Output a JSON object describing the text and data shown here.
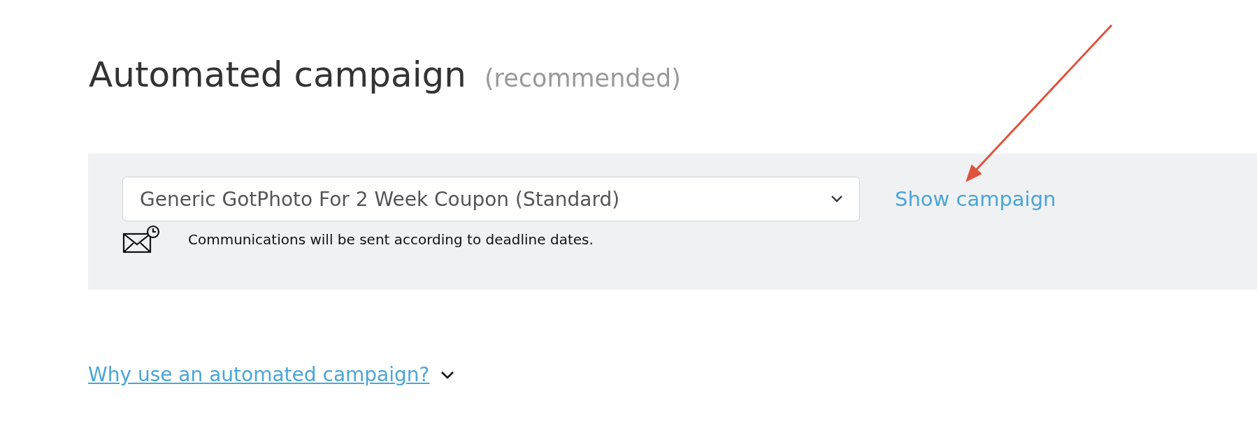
{
  "heading": {
    "title": "Automated campaign",
    "note": "(recommended)"
  },
  "campaign_panel": {
    "select": {
      "value": "Generic GotPhoto For 2 Week Coupon (Standard)"
    },
    "link": "Show campaign",
    "info": "Communications will be sent according to deadline dates."
  },
  "faq": {
    "label": "Why use an automated campaign?",
    "expanded": false
  },
  "annotation": {
    "kind": "arrow",
    "color": "#e0533d"
  }
}
